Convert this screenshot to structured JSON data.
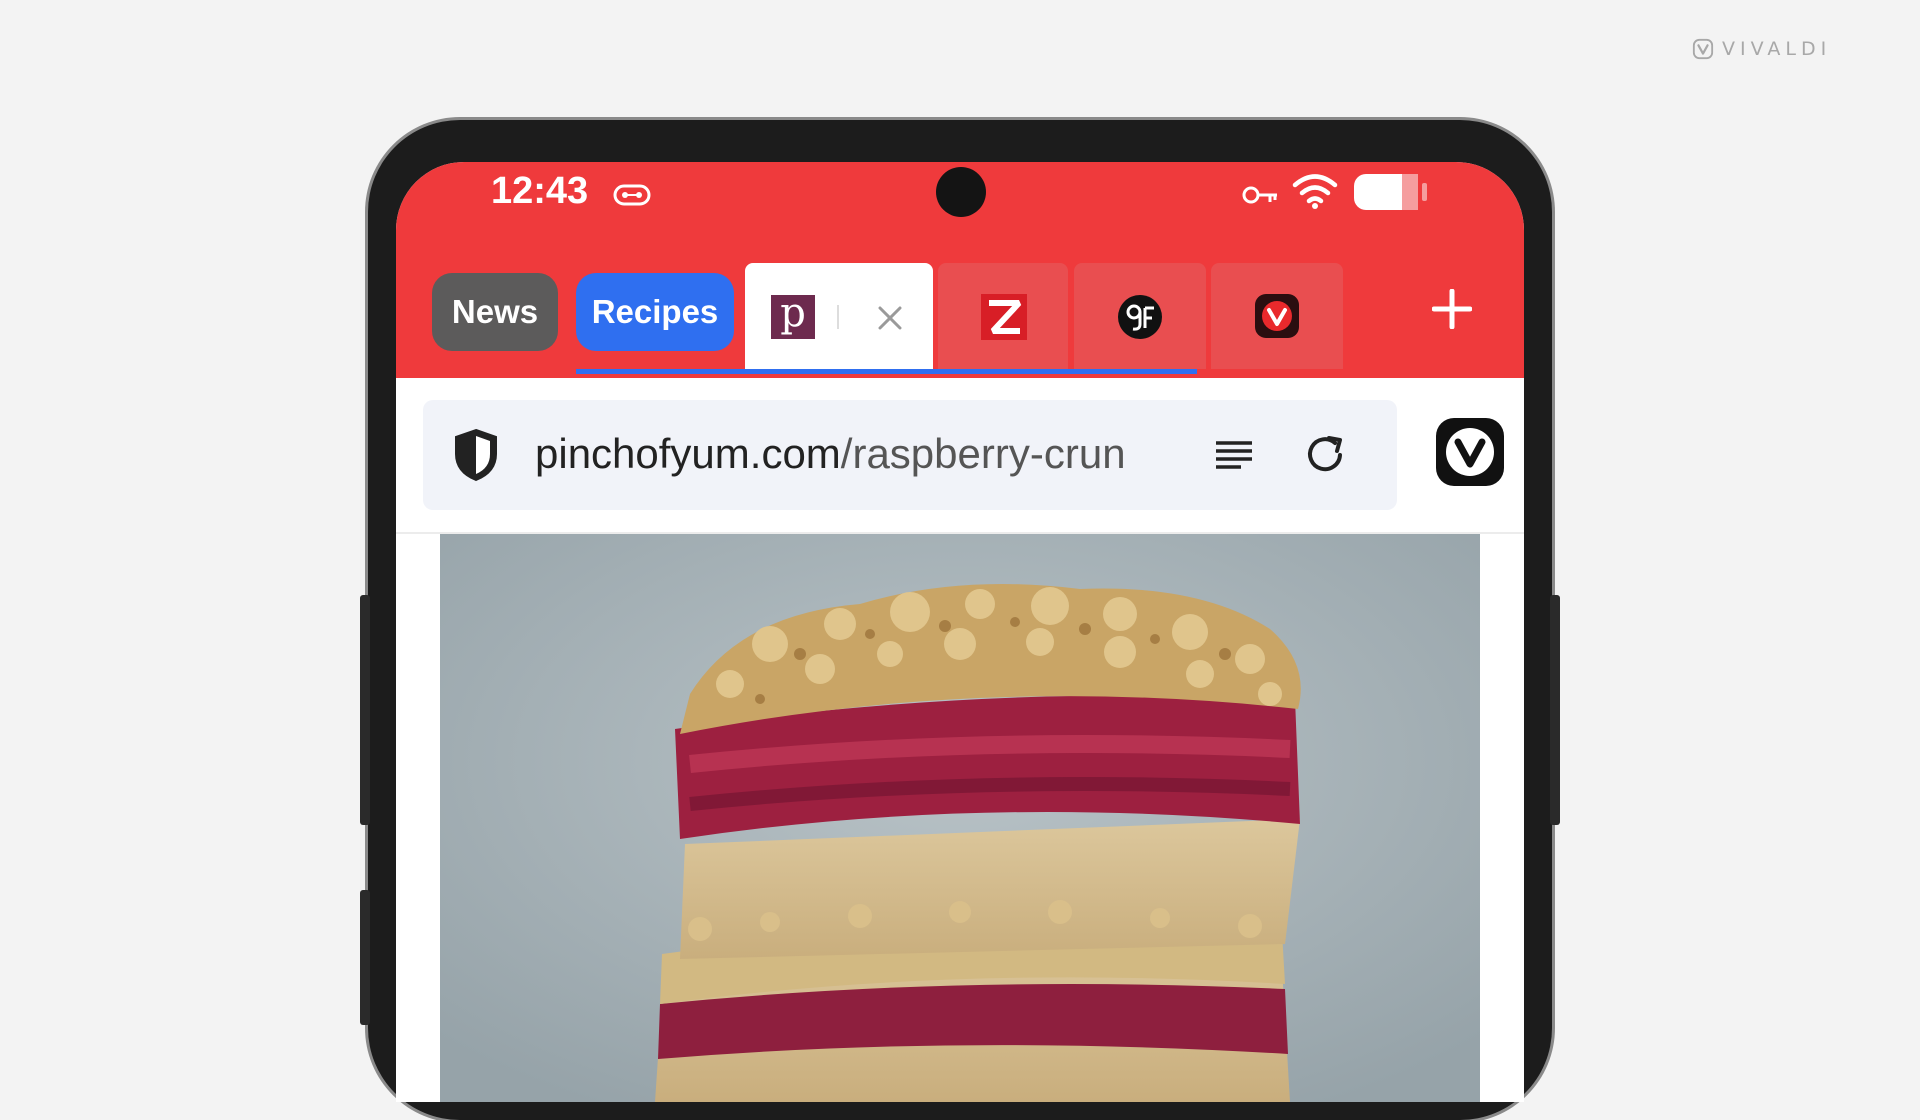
{
  "brand": {
    "name": "VIVALDI",
    "icon": "vivaldi-logo-icon"
  },
  "status_bar": {
    "time": "12:43",
    "icons": [
      "tape-icon",
      "vpn-key-icon",
      "wifi-icon",
      "battery-icon"
    ]
  },
  "tab_bar": {
    "stacks": [
      {
        "label": "News",
        "color": "#5c5b5b"
      },
      {
        "label": "Recipes",
        "color": "#2f6ff0"
      }
    ],
    "active_tab": {
      "favicon": "pinch-of-yum-favicon",
      "favicon_letter": "p",
      "close_icon": "close-icon"
    },
    "tabs": [
      {
        "favicon": "zeit-favicon"
      },
      {
        "favicon": "gf-favicon"
      },
      {
        "favicon": "vivaldi-favicon"
      }
    ],
    "new_tab_icon": "plus-icon"
  },
  "address_bar": {
    "domain": "pinchofyum.com",
    "path": "/raspberry-crun",
    "shield_icon": "shield-icon",
    "reader_icon": "reader-view-icon",
    "reload_icon": "reload-icon",
    "menu_icon": "vivaldi-menu-icon"
  },
  "content": {
    "image": "raspberry-crumble-bars-photo"
  },
  "colors": {
    "toolbar": "#ef3a3c",
    "stack_recipes": "#2f6ff0",
    "stack_news": "#5c5b5b",
    "url_field": "#f1f3f9"
  }
}
